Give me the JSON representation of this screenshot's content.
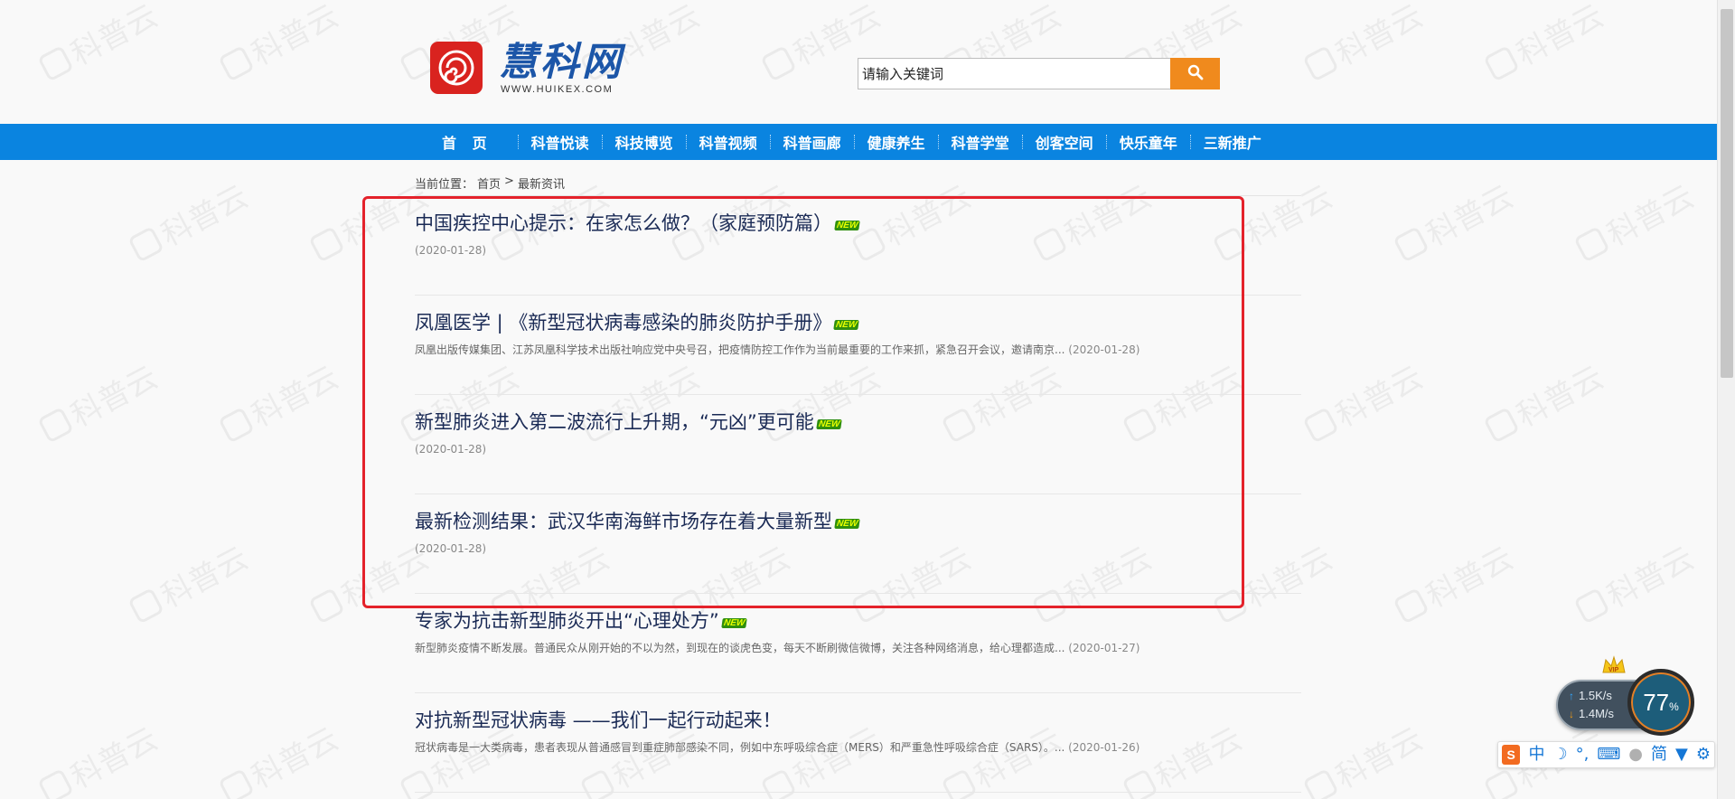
{
  "site": {
    "logo_cn": "慧科网",
    "logo_en": "WWW.HUIKEX.COM",
    "watermark_text": "科普云"
  },
  "search": {
    "placeholder": "请输入关键词",
    "button_icon": "search-icon"
  },
  "nav": {
    "items": [
      "首 页",
      "科普悦读",
      "科技博览",
      "科普视频",
      "科普画廊",
      "健康养生",
      "科普学堂",
      "创客空间",
      "快乐童年",
      "三新推广"
    ]
  },
  "breadcrumb": {
    "prefix": "当前位置：",
    "home": "首页",
    "separator": ">",
    "current": "最新资讯"
  },
  "news": [
    {
      "title": "中国疾控中心提示：在家怎么做？（家庭预防篇）",
      "new_badge": "NEW",
      "summary": "",
      "date": "(2020-01-28)"
    },
    {
      "title": "凤凰医学 | 《新型冠状病毒感染的肺炎防护手册》",
      "new_badge": "NEW",
      "summary": "凤凰出版传媒集团、江苏凤凰科学技术出版社响应党中央号召，把疫情防控工作作为当前最重要的工作来抓，紧急召开会议，邀请南京...",
      "date": "(2020-01-28)"
    },
    {
      "title": "新型肺炎进入第二波流行上升期，“元凶”更可能",
      "new_badge": "NEW",
      "summary": "",
      "date": "(2020-01-28)"
    },
    {
      "title": "最新检测结果：武汉华南海鲜市场存在着大量新型",
      "new_badge": "NEW",
      "summary": "",
      "date": "(2020-01-28)"
    },
    {
      "title": "专家为抗击新型肺炎开出“心理处方”",
      "new_badge": "NEW",
      "summary": "新型肺炎疫情不断发展。普通民众从刚开始的不以为然，到现在的谈虎色变，每天不断刷微信微博，关注各种网络消息，给心理都造成...",
      "date": "(2020-01-27)"
    },
    {
      "title": "对抗新型冠状病毒 ——我们一起行动起来！",
      "new_badge": "",
      "summary": "冠状病毒是一大类病毒，患者表现从普通感冒到重症肺部感染不同，例如中东呼吸综合症（MERS）和严重急性呼吸综合症（SARS）。...",
      "date": "(2020-01-26)"
    }
  ],
  "speed_widget": {
    "upload": "1.5K/s",
    "download": "1.4M/s",
    "percent": "77",
    "percent_sign": "%"
  },
  "ime": {
    "mode": "中",
    "simplified": "简",
    "icons": [
      "sogou-logo-icon",
      "moon-icon",
      "punctuation-icon",
      "keyboard-icon",
      "user-icon",
      "skin-icon",
      "settings-icon"
    ]
  },
  "colors": {
    "nav_bg": "#0a84e0",
    "search_btn": "#f08a1d",
    "highlight_border": "#e4222b",
    "logo_red": "#d9231f",
    "logo_blue": "#1c56a8"
  }
}
